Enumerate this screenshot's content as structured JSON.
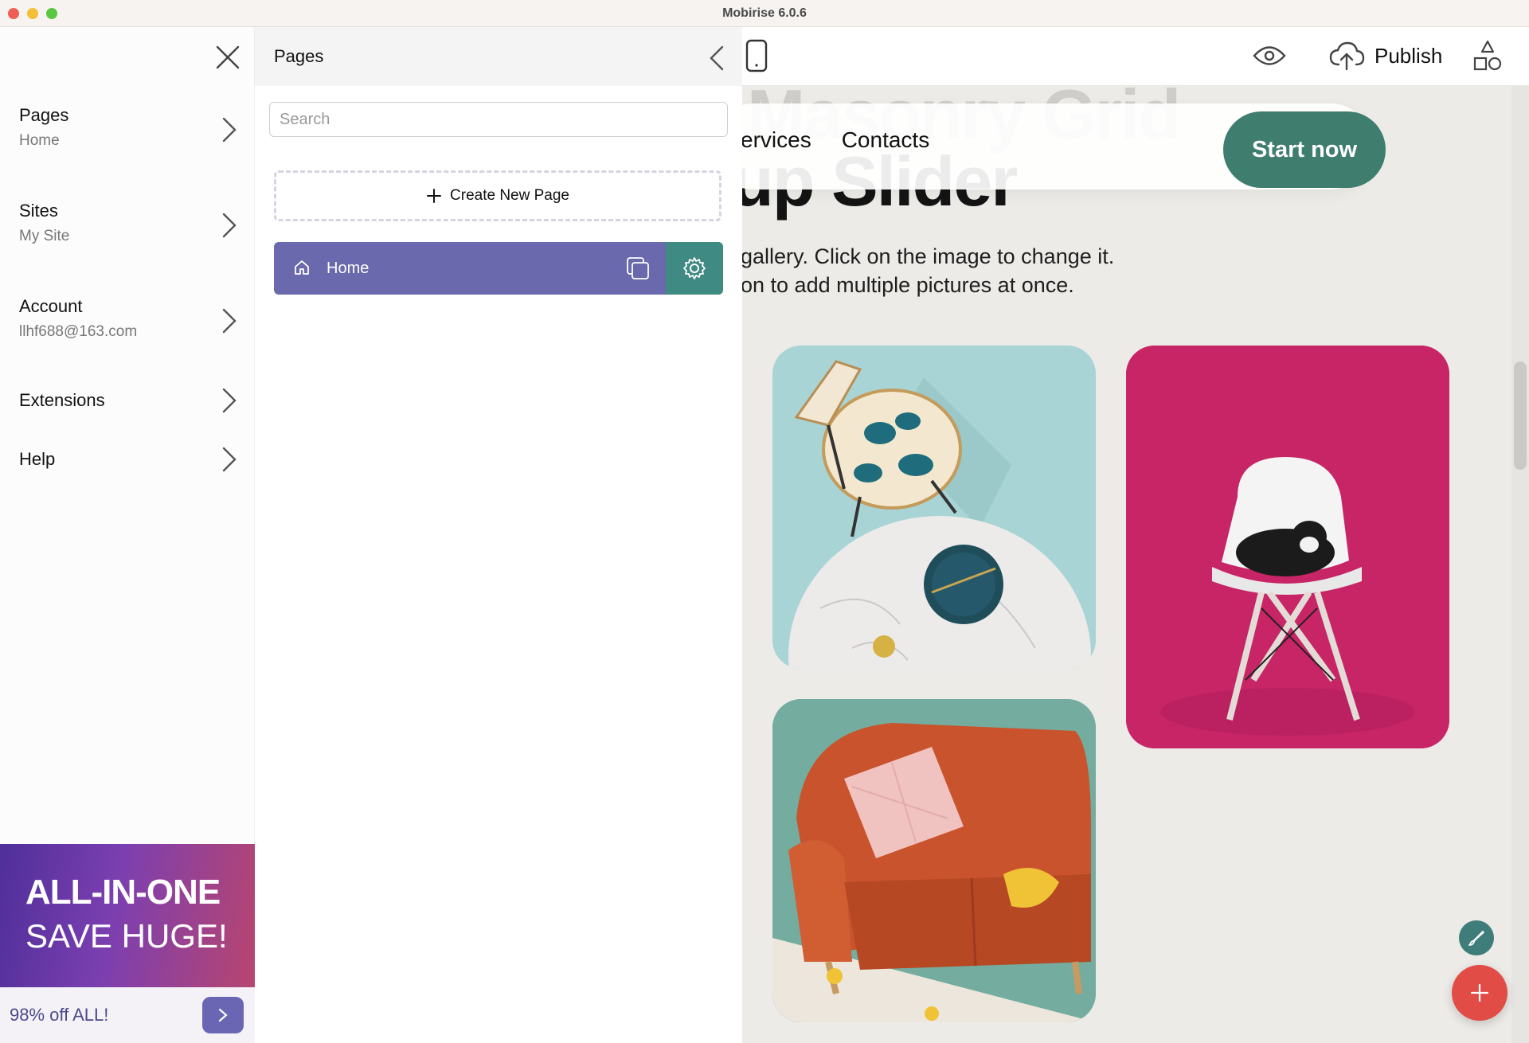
{
  "window": {
    "title": "Mobirise 6.0.6"
  },
  "sidebar": {
    "items": [
      {
        "label": "Pages",
        "sub": "Home"
      },
      {
        "label": "Sites",
        "sub": "My Site"
      },
      {
        "label": "Account",
        "sub": "llhf688@163.com"
      },
      {
        "label": "Extensions",
        "sub": ""
      },
      {
        "label": "Help",
        "sub": ""
      }
    ],
    "promo": {
      "line1": "ALL-IN-ONE",
      "line2": "SAVE HUGE!",
      "offer": "98% off ALL!"
    }
  },
  "pages_panel": {
    "title": "Pages",
    "search_placeholder": "Search",
    "create_label": "Create New Page",
    "pages": [
      {
        "name": "Home"
      }
    ]
  },
  "toolbar": {
    "publish_label": "Publish"
  },
  "preview": {
    "title_line1": "Masonry Grid",
    "title_line2": "up Slider",
    "nav": [
      "ervices",
      "Contacts"
    ],
    "cta": "Start now",
    "desc_line1": "gallery. Click on the image to change it.",
    "desc_line2": "on to add multiple pictures at once."
  },
  "colors": {
    "accent_purple": "#6a69ad",
    "accent_teal": "#3f8a82",
    "cta_green": "#3f7d6e",
    "fab_red": "#e24c47"
  }
}
